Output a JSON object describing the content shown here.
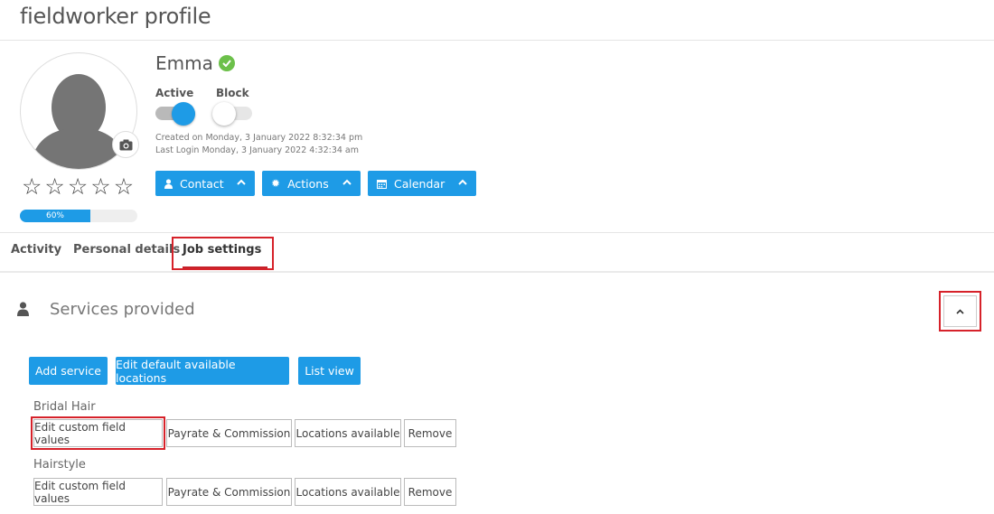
{
  "page": {
    "title": "fieldworker profile"
  },
  "profile": {
    "name": "Emma",
    "rating": 0,
    "progress_percent": 60,
    "progress_label": "60%",
    "active_label": "Active",
    "block_label": "Block",
    "active_on": true,
    "block_on": false,
    "created": "Created on Monday, 3 January 2022 8:32:34 pm",
    "last_login": "Last Login Monday, 3 January 2022 4:32:34 am"
  },
  "actions": {
    "contact": "Contact",
    "actions": "Actions",
    "calendar": "Calendar"
  },
  "tabs": [
    {
      "label": "Activity"
    },
    {
      "label": "Personal details"
    },
    {
      "label": "Job settings"
    }
  ],
  "section": {
    "title": "Services provided",
    "buttons": {
      "add": "Add service",
      "edit_locations": "Edit default available locations",
      "list_view": "List view"
    }
  },
  "services": [
    {
      "name": "Bridal Hair",
      "edit": "Edit custom field values",
      "payrate": "Payrate & Commission",
      "locations": "Locations available",
      "remove": "Remove"
    },
    {
      "name": "Hairstyle",
      "edit": "Edit custom field values",
      "payrate": "Payrate & Commission",
      "locations": "Locations available",
      "remove": "Remove"
    }
  ],
  "colors": {
    "primary": "#1e9be6",
    "highlight": "#d6222a",
    "success": "#6cc04a"
  }
}
